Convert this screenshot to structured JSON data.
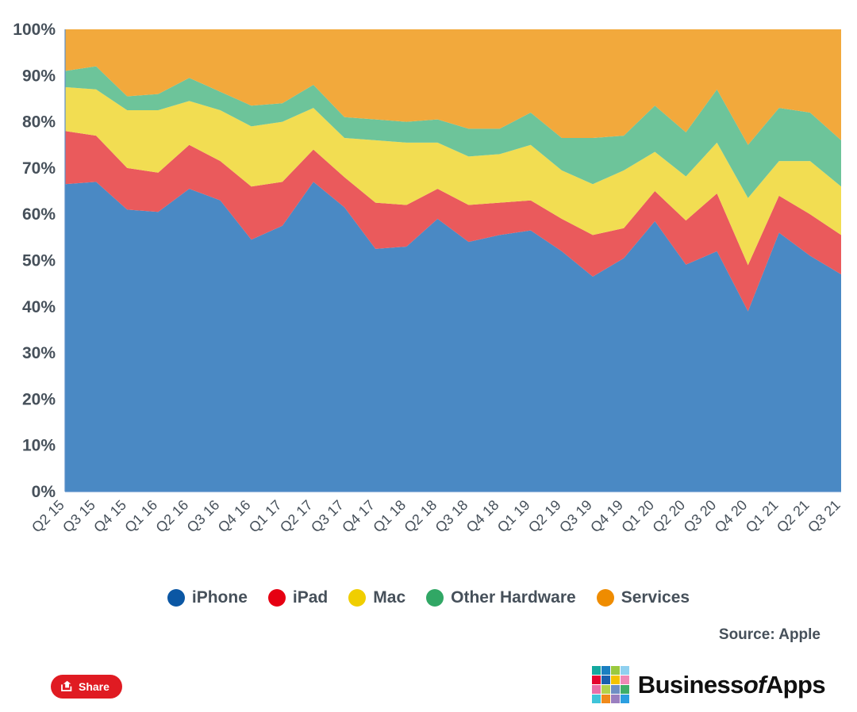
{
  "chart_data": {
    "type": "area",
    "stacked": true,
    "normalized_percent": true,
    "title": "",
    "subtitle": "",
    "xlabel": "",
    "ylabel": "",
    "ylim": [
      0,
      100
    ],
    "ytick_values": [
      0,
      10,
      20,
      30,
      40,
      50,
      60,
      70,
      80,
      90,
      100
    ],
    "ytick_labels": [
      "0%",
      "10%",
      "20%",
      "30%",
      "40%",
      "50%",
      "60%",
      "70%",
      "80%",
      "90%",
      "100%"
    ],
    "grid": false,
    "legend_position": "bottom",
    "categories": [
      "Q2 15",
      "Q3 15",
      "Q4 15",
      "Q1 16",
      "Q2 16",
      "Q3 16",
      "Q4 16",
      "Q1 17",
      "Q2 17",
      "Q3 17",
      "Q4 17",
      "Q1 18",
      "Q2 18",
      "Q3 18",
      "Q4 18",
      "Q1 19",
      "Q2 19",
      "Q3 19",
      "Q4 19",
      "Q1 20",
      "Q2 20",
      "Q3 20",
      "Q4 20",
      "Q1 21",
      "Q2 21",
      "Q3 21"
    ],
    "series": [
      {
        "name": "iPhone",
        "color": "#4a89c4",
        "legend_color": "#0b57a4",
        "values": [
          66.5,
          67.0,
          61.0,
          60.5,
          65.5,
          63.0,
          54.5,
          57.5,
          67.0,
          61.5,
          52.5,
          53.0,
          59.0,
          54.0,
          55.5,
          56.5,
          52.0,
          46.5,
          50.5,
          58.5,
          54.0,
          52.0,
          39.0,
          56.0,
          51.0,
          47.0
        ]
      },
      {
        "name": "iPad",
        "color": "#ea5a5c",
        "legend_color": "#e60012",
        "values": [
          11.5,
          10.0,
          9.0,
          8.5,
          9.5,
          8.5,
          11.5,
          9.5,
          7.0,
          6.5,
          10.0,
          9.0,
          6.5,
          8.0,
          7.0,
          6.5,
          7.0,
          9.0,
          6.5,
          6.5,
          10.5,
          12.5,
          10.0,
          8.0,
          9.0,
          8.5
        ]
      },
      {
        "name": "Mac",
        "color": "#f2dd52",
        "legend_color": "#f0ce00",
        "values": [
          9.5,
          10.0,
          12.5,
          13.5,
          9.5,
          11.0,
          13.0,
          13.0,
          9.0,
          8.5,
          13.5,
          13.5,
          10.0,
          10.5,
          10.5,
          12.0,
          10.5,
          11.0,
          12.5,
          8.5,
          10.5,
          11.0,
          14.5,
          7.5,
          11.5,
          10.5
        ]
      },
      {
        "name": "Other Hardware",
        "color": "#6dc49a",
        "legend_color": "#31a765",
        "values": [
          3.5,
          5.0,
          3.0,
          3.5,
          5.0,
          4.0,
          4.5,
          4.0,
          5.0,
          4.5,
          4.5,
          4.5,
          5.0,
          6.0,
          5.5,
          7.0,
          7.0,
          10.0,
          7.5,
          10.0,
          10.5,
          11.5,
          11.5,
          11.5,
          10.5,
          10.0
        ]
      },
      {
        "name": "Services",
        "color": "#f2a93c",
        "legend_color": "#ef8c00",
        "values": [
          9.0,
          8.0,
          14.5,
          14.0,
          10.5,
          13.5,
          16.5,
          16.0,
          12.0,
          19.0,
          19.5,
          20.0,
          19.5,
          21.5,
          21.5,
          18.0,
          23.5,
          23.5,
          23.0,
          16.5,
          24.5,
          13.0,
          25.0,
          17.0,
          18.0,
          24.0
        ]
      }
    ]
  },
  "legend": {
    "items": [
      {
        "label": "iPhone",
        "color": "#0b57a4"
      },
      {
        "label": "iPad",
        "color": "#e60012"
      },
      {
        "label": "Mac",
        "color": "#f0ce00"
      },
      {
        "label": "Other Hardware",
        "color": "#31a765"
      },
      {
        "label": "Services",
        "color": "#ef8c00"
      }
    ]
  },
  "source": {
    "text": "Source: Apple"
  },
  "footer": {
    "share_label": "Share",
    "share_color": "#e01b22",
    "brand_first": "Business",
    "brand_of": "of",
    "brand_last": "Apps",
    "brand_grid_colors": [
      "#13a89e",
      "#1a7fc1",
      "#9ac93e",
      "#8fd0ef",
      "#e4032e",
      "#1a5fae",
      "#f4c300",
      "#ef88b5",
      "#e86ea8",
      "#b2d24b",
      "#6f8fc4",
      "#3fae68",
      "#3fc4d9",
      "#f08a1c",
      "#9a7fc0",
      "#2b9fe0"
    ]
  }
}
